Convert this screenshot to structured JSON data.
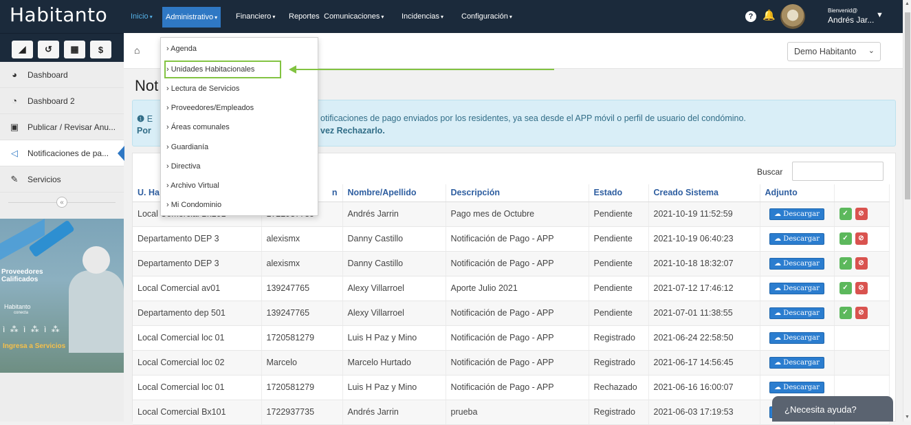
{
  "app": {
    "logo": "Habitanto"
  },
  "shortcuts": [
    {
      "icon": "paper-plane-icon",
      "glyph": "◢"
    },
    {
      "icon": "history-icon",
      "glyph": "↺"
    },
    {
      "icon": "calculator-icon",
      "glyph": "▦"
    },
    {
      "icon": "dollar-icon",
      "glyph": "$"
    }
  ],
  "sidebar": {
    "items": [
      {
        "label": "Dashboard",
        "icon": "dashboard-icon",
        "glyph": "◕"
      },
      {
        "label": "Dashboard 2",
        "icon": "pie-chart-icon",
        "glyph": "◔"
      },
      {
        "label": "Publicar / Revisar Anu...",
        "icon": "image-icon",
        "glyph": "▣"
      },
      {
        "label": "Notificaciones de pa...",
        "icon": "bullhorn-icon",
        "glyph": "◁"
      },
      {
        "label": "Servicios",
        "icon": "wrench-icon",
        "glyph": "✎"
      }
    ],
    "collapse_glyph": "«",
    "promo": {
      "title": "Proveedores Calificados",
      "brand": "Habitanto",
      "brand_sub": "conecta",
      "icons": "ì ⁂ ì ⁂ ì ⁂",
      "cta": "Ingresa a Servicios"
    }
  },
  "topbar": {
    "menus": [
      {
        "label": "Inicio",
        "caret": "▾"
      },
      {
        "label": "Administrativo",
        "caret": "▾"
      },
      {
        "label": "Financiero",
        "caret": "▾"
      },
      {
        "label": "Reportes",
        "caret": ""
      },
      {
        "label": "Comunicaciones",
        "caret": "▾"
      },
      {
        "label": "Incidencias",
        "caret": "▾"
      },
      {
        "label": "Configuración",
        "caret": "▾"
      }
    ],
    "help_glyph": "?",
    "bell_glyph": "🔔",
    "welcome": "Bienvenid@",
    "username": "Andrés Jar...",
    "user_caret": "▼"
  },
  "admin_dropdown": {
    "items": [
      "› Agenda",
      "› Unidades Habitacionales",
      "› Lectura de Servicios",
      "› Proveedores/Empleados",
      "› Áreas comunales",
      "› Guardianía",
      "› Directiva",
      "› Archivo Virtual",
      "› Mi Condominio"
    ],
    "highlighted": "› Unidades Habitacionales"
  },
  "breadcrumb": {
    "home_glyph": "⌂"
  },
  "condo_select": {
    "value": "Demo Habitanto",
    "chevron": "⌄"
  },
  "page": {
    "title": "Not"
  },
  "alert": {
    "line1_start": "E",
    "line1_end": "otificaciones de pago enviados por los residentes, ya sea desde el APP móvil o perfil de usuario del condómino.",
    "line2_start": "Por",
    "line2_end": "vez Rechazarlo.",
    "info_glyph": "❶"
  },
  "table": {
    "search_label": "Buscar",
    "search_value": "",
    "columns": [
      "U. Ha",
      "n",
      "Nombre/Apellido",
      "Descripción",
      "Estado",
      "Creado Sistema",
      "Adjunto",
      ""
    ],
    "download_label": "☁ Descargar",
    "approve_glyph": "✓",
    "reject_glyph": "⊘",
    "rows": [
      {
        "unit": "Local Comercial Bx101",
        "id": "1722937735",
        "name": "Andrés Jarrin",
        "desc": "Pago mes de Octubre",
        "status": "Pendiente",
        "created": "2021-10-19 11:52:59",
        "actions": true
      },
      {
        "unit": "Departamento DEP 3",
        "id": "alexismx",
        "name": "Danny Castillo",
        "desc": "Notificación de Pago - APP",
        "status": "Pendiente",
        "created": "2021-10-19 06:40:23",
        "actions": true
      },
      {
        "unit": "Departamento DEP 3",
        "id": "alexismx",
        "name": "Danny Castillo",
        "desc": "Notificación de Pago - APP",
        "status": "Pendiente",
        "created": "2021-10-18 18:32:07",
        "actions": true
      },
      {
        "unit": "Local Comercial av01",
        "id": "139247765",
        "name": "Alexy Villarroel",
        "desc": "Aporte Julio 2021",
        "status": "Pendiente",
        "created": "2021-07-12 17:46:12",
        "actions": true
      },
      {
        "unit": "Departamento dep 501",
        "id": "139247765",
        "name": "Alexy Villarroel",
        "desc": "Notificación de Pago - APP",
        "status": "Pendiente",
        "created": "2021-07-01 11:38:55",
        "actions": true
      },
      {
        "unit": "Local Comercial loc 01",
        "id": "1720581279",
        "name": "Luis H Paz y Mino",
        "desc": "Notificación de Pago - APP",
        "status": "Registrado",
        "created": "2021-06-24 22:58:50",
        "actions": false
      },
      {
        "unit": "Local Comercial loc 02",
        "id": "Marcelo",
        "name": "Marcelo Hurtado",
        "desc": "Notificación de Pago - APP",
        "status": "Registrado",
        "created": "2021-06-17 14:56:45",
        "actions": false
      },
      {
        "unit": "Local Comercial loc 01",
        "id": "1720581279",
        "name": "Luis H Paz y Mino",
        "desc": "Notificación de Pago - APP",
        "status": "Rechazado",
        "created": "2021-06-16 16:00:07",
        "actions": false
      },
      {
        "unit": "Local Comercial Bx101",
        "id": "1722937735",
        "name": "Andrés Jarrin",
        "desc": "prueba",
        "status": "Registrado",
        "created": "2021-06-03 17:19:53",
        "actions": false
      }
    ]
  },
  "help_chat": {
    "label": "¿Necesita ayuda?"
  },
  "colors": {
    "navbar": "#1b2a3b",
    "accent": "#2f78c4",
    "highlight": "#82c341",
    "approve": "#5cb85c",
    "reject": "#d9534f"
  }
}
